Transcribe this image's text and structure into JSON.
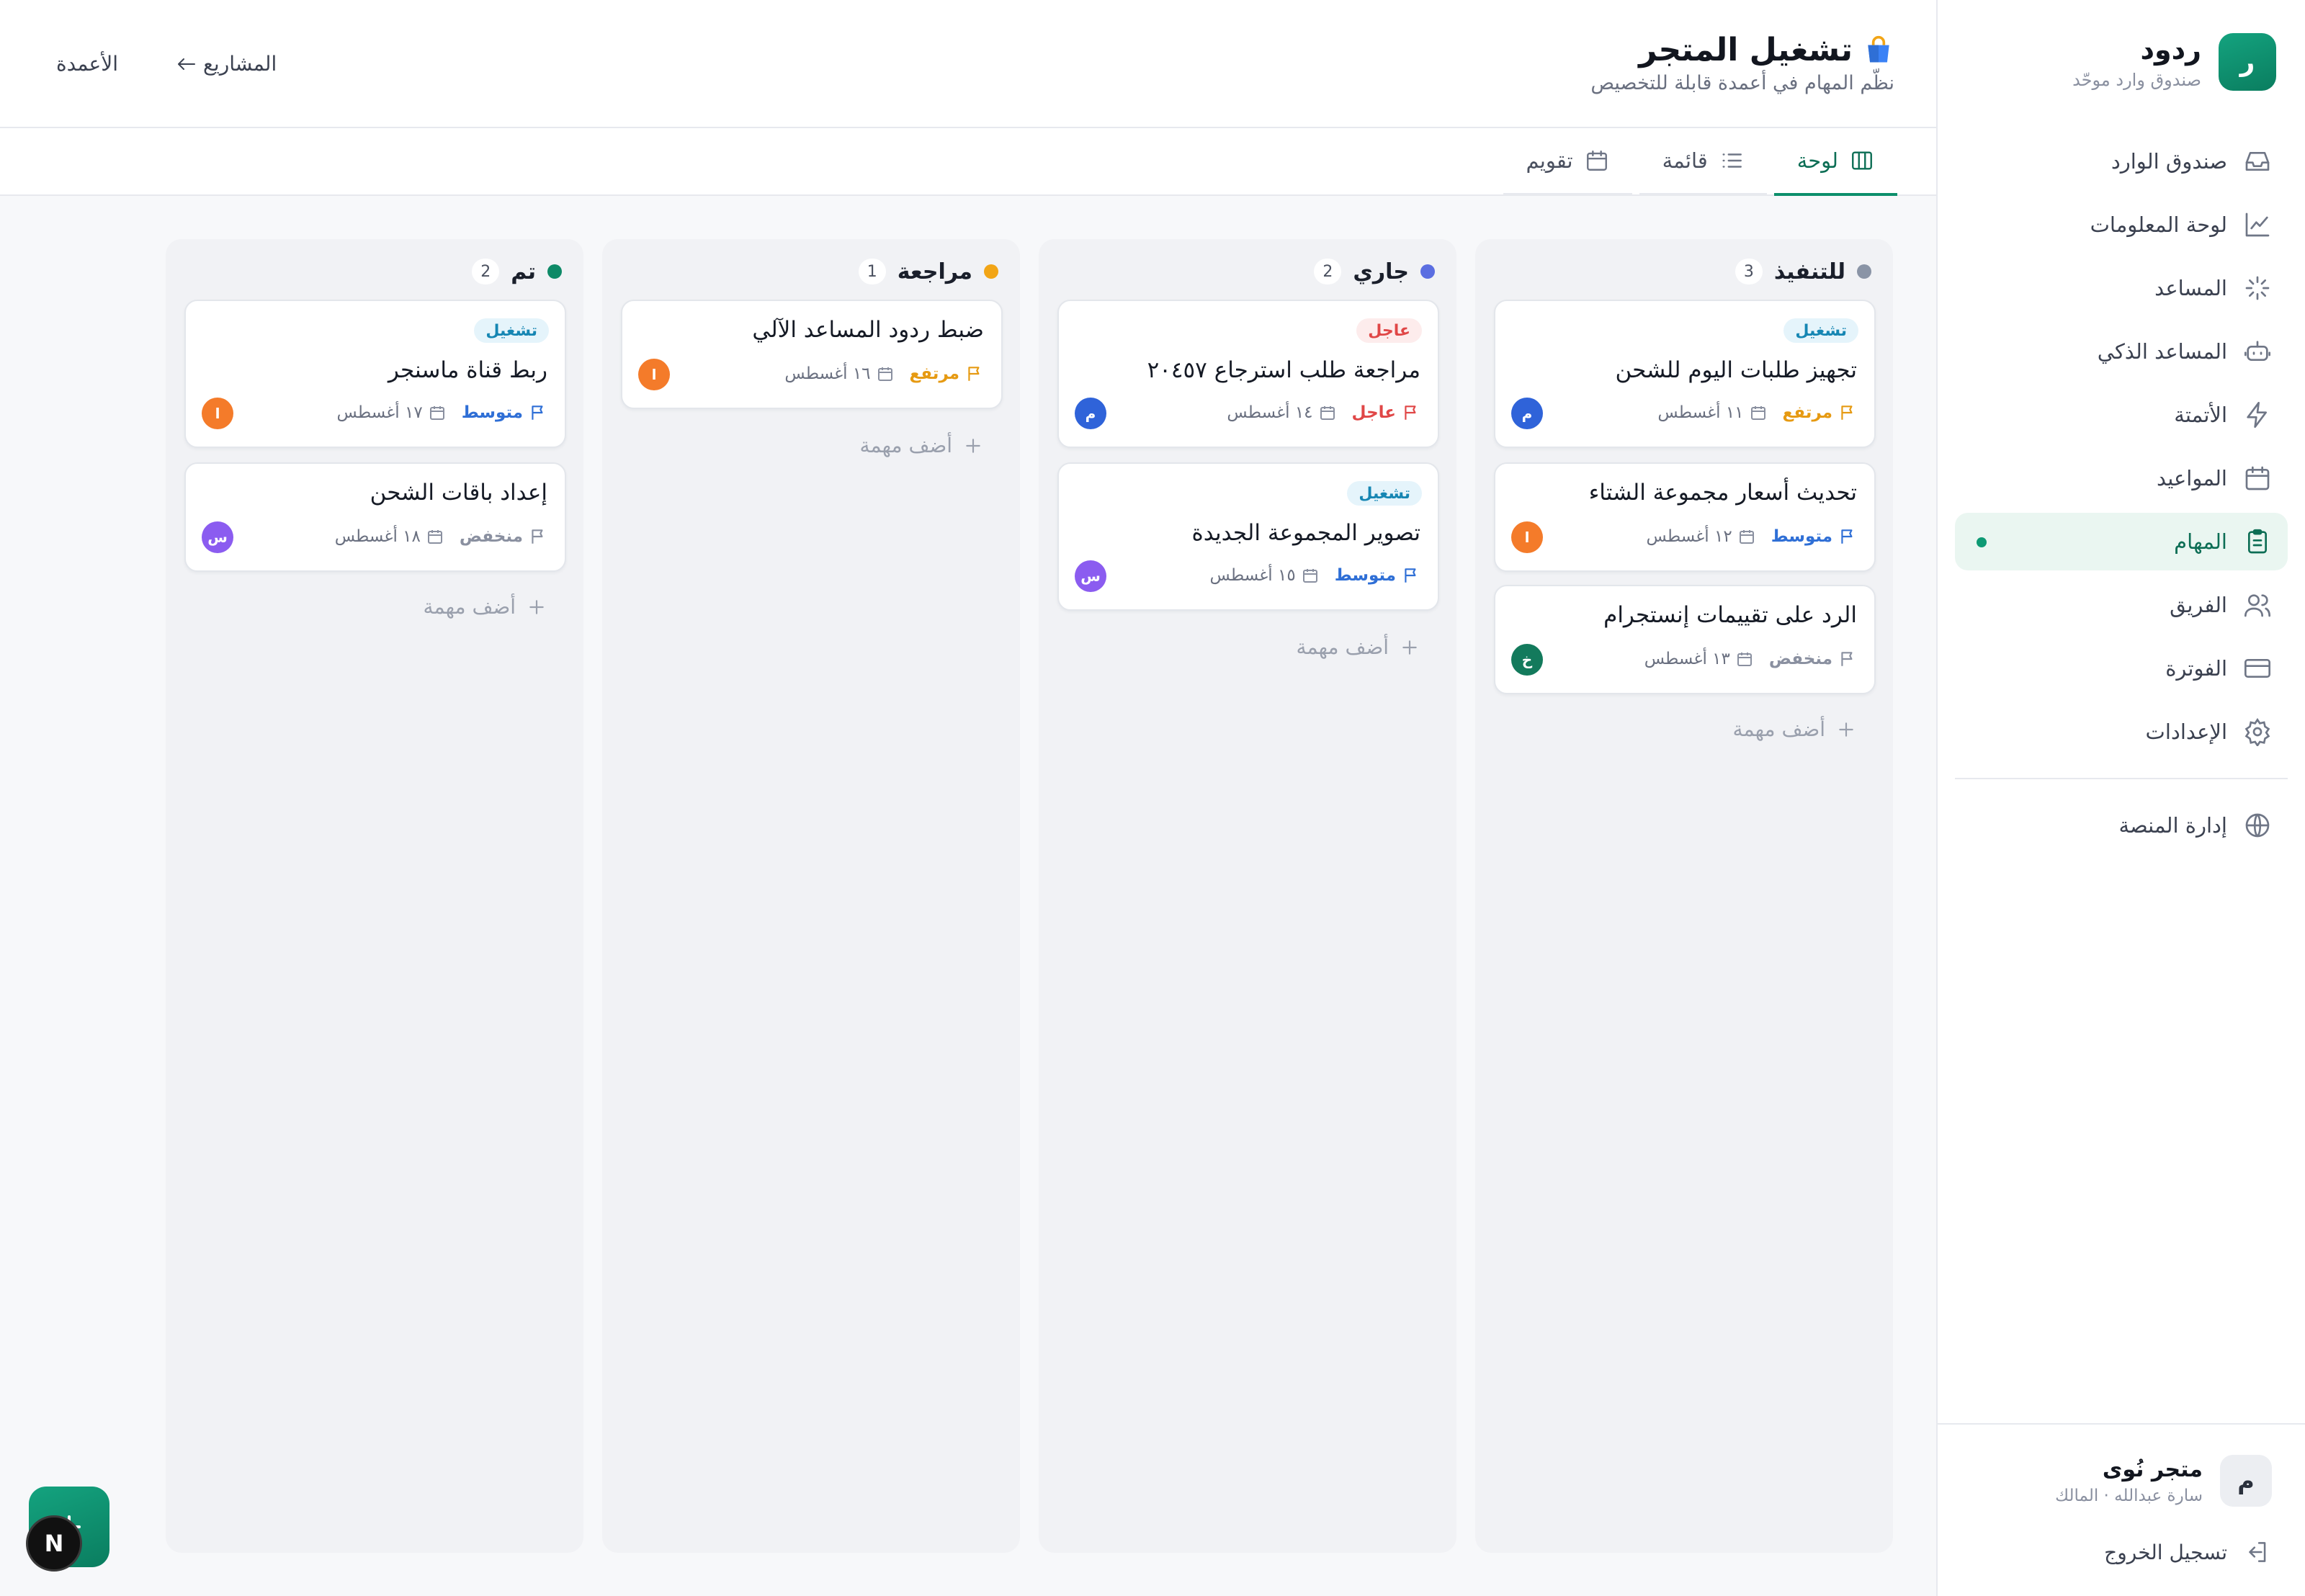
{
  "brand": {
    "logo_letter": "ر",
    "name": "ردود",
    "subtitle": "صندوق وارد موحّد"
  },
  "nav": [
    {
      "label": "صندوق الوارد",
      "icon": "inbox-icon"
    },
    {
      "label": "لوحة المعلومات",
      "icon": "chart-icon"
    },
    {
      "label": "المساعد",
      "icon": "sparkle-icon"
    },
    {
      "label": "المساعد الذكي",
      "icon": "bot-icon"
    },
    {
      "label": "الأتمتة",
      "icon": "lightning-icon"
    },
    {
      "label": "المواعيد",
      "icon": "calendar-icon"
    },
    {
      "label": "المهام",
      "icon": "clipboard-icon",
      "active": true
    },
    {
      "label": "الفريق",
      "icon": "users-icon"
    },
    {
      "label": "الفوترة",
      "icon": "credit-card-icon"
    },
    {
      "label": "الإعدادات",
      "icon": "gear-icon"
    }
  ],
  "admin": {
    "label": "إدارة المنصة",
    "icon": "globe-icon"
  },
  "account": {
    "avatar": "م",
    "name": "متجر نُوى",
    "role": "سارة عبدالله · المالك",
    "logout": "تسجيل الخروج"
  },
  "header": {
    "title": "تشغيل المتجر",
    "subtitle": "نظّم المهام في أعمدة قابلة للتخصيص",
    "back_link": "المشاريع",
    "columns_link": "الأعمدة"
  },
  "tabs": [
    {
      "label": "لوحة",
      "icon": "board-icon",
      "active": true
    },
    {
      "label": "قائمة",
      "icon": "list-icon"
    },
    {
      "label": "تقويم",
      "icon": "calendar-icon"
    }
  ],
  "colors": {
    "accent": "#0d8f6b",
    "todo": "#8a94a6",
    "doing": "#5b6ee1",
    "review": "#f2a516",
    "done": "#0e8a67",
    "high": "#e69a12",
    "medium": "#2f6fd6",
    "low": "#8a90a0",
    "urgent": "#e04747"
  },
  "add_task_label": "أضف مهمة",
  "columns": [
    {
      "title": "للتنفيذ",
      "count": "3",
      "dot": "#8a94a6",
      "cards": [
        {
          "tag": "تشغيل",
          "tag_kind": "ops",
          "title": "تجهيز طلبات اليوم للشحن",
          "priority": "مرتفع",
          "prio_color": "#e69a12",
          "due": "١١ أغسطس",
          "avatar": "م",
          "avatar_color": "#2f63d9"
        },
        {
          "tag": "",
          "title": "تحديث أسعار مجموعة الشتاء",
          "priority": "متوسط",
          "prio_color": "#2f6fd6",
          "due": "١٢ أغسطس",
          "avatar": "ا",
          "avatar_color": "#f47b2a"
        },
        {
          "tag": "",
          "title": "الرد على تقييمات إنستجرام",
          "priority": "منخفض",
          "prio_color": "#8a90a0",
          "due": "١٣ أغسطس",
          "avatar": "خ",
          "avatar_color": "#137a5c"
        }
      ]
    },
    {
      "title": "جاري",
      "count": "2",
      "dot": "#5b6ee1",
      "cards": [
        {
          "tag": "عاجل",
          "tag_kind": "urgent",
          "title": "مراجعة طلب استرجاع ٢٠٤٥٧",
          "priority": "عاجل",
          "prio_color": "#e04747",
          "due": "١٤ أغسطس",
          "avatar": "م",
          "avatar_color": "#2f63d9"
        },
        {
          "tag": "تشغيل",
          "tag_kind": "ops",
          "title": "تصوير المجموعة الجديدة",
          "priority": "متوسط",
          "prio_color": "#2f6fd6",
          "due": "١٥ أغسطس",
          "avatar": "س",
          "avatar_color": "#8b5cf0"
        }
      ]
    },
    {
      "title": "مراجعة",
      "count": "1",
      "dot": "#f2a516",
      "cards": [
        {
          "tag": "",
          "title": "ضبط ردود المساعد الآلي",
          "priority": "مرتفع",
          "prio_color": "#e69a12",
          "due": "١٦ أغسطس",
          "avatar": "ا",
          "avatar_color": "#f47b2a"
        }
      ]
    },
    {
      "title": "تم",
      "count": "2",
      "dot": "#0e8a67",
      "cards": [
        {
          "tag": "تشغيل",
          "tag_kind": "ops",
          "title": "ربط قناة ماسنجر",
          "priority": "متوسط",
          "prio_color": "#2f6fd6",
          "due": "١٧ أغسطس",
          "avatar": "ا",
          "avatar_color": "#f47b2a"
        },
        {
          "tag": "",
          "title": "إعداد باقات الشحن",
          "priority": "منخفض",
          "prio_color": "#8a90a0",
          "due": "١٨ أغسطس",
          "avatar": "س",
          "avatar_color": "#8b5cf0"
        }
      ]
    }
  ],
  "floating": {
    "next_badge": "N"
  }
}
